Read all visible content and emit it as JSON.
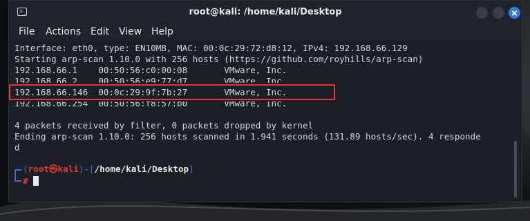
{
  "window": {
    "title": "root@kali: /home/kali/Desktop"
  },
  "menu": {
    "items": [
      "File",
      "Actions",
      "Edit",
      "View",
      "Help"
    ]
  },
  "terminal": {
    "lines": [
      "Interface: eth0, type: EN10MB, MAC: 00:0c:29:72:d8:12, IPv4: 192.168.66.129",
      "Starting arp-scan 1.10.0 with 256 hosts (https://github.com/royhills/arp-scan)",
      "192.168.66.1    00:50:56:c0:00:08       VMware, Inc.",
      "192.168.66.2    00:50:56:e9:77:d7       VMware, Inc.",
      "192.168.66.146  00:0c:29:9f:7b:27       VMware, Inc.",
      "192.168.66.254  00:50:56:f8:57:b0       VMware, Inc.",
      "",
      "4 packets received by filter, 0 packets dropped by kernel",
      "Ending arp-scan 1.10.0: 256 hosts scanned in 1.941 seconds (131.89 hosts/sec). 4 responde",
      "d"
    ],
    "prompt": {
      "open": "(",
      "user": "root",
      "at_symbol": "㉿",
      "host": "kali",
      "close": ")-[",
      "path": "/home/kali/Desktop",
      "path_close": "]",
      "symbol": "#"
    }
  },
  "colors": {
    "accent_blue": "#3b6fd6",
    "prompt_red": "#e53935",
    "highlight_red": "#e03a3a",
    "close_button": "#2f7fe0"
  }
}
